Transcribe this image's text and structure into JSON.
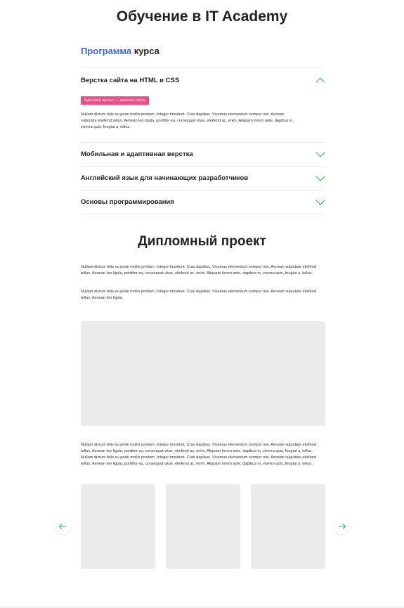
{
  "page": {
    "title": "Обучение в IT Academy"
  },
  "program": {
    "heading_accent": "Программа",
    "heading_rest": " курса",
    "items": [
      {
        "title": "Верстка сайта на HTML и CSS",
        "expanded": true,
        "tag": "Курсовой проект — верстка сайта",
        "text": "Nullam dictum felis eu pede mollis pretium. Integer tincidunt. Cras dapibus. Vivamus elementum semper nisi. Aenean vulputate eleifend tellus. Aenean leo ligula, porttitor eu, consequat vitae, eleifend ac, enim. Aliquam lorem ante, dapibus in, viverra quis, feugiat a, tellus."
      },
      {
        "title": "Мобильная и адаптивная верстка",
        "expanded": false
      },
      {
        "title": "Английский язык для начинающих разработчиков",
        "expanded": false
      },
      {
        "title": "Основы программирования",
        "expanded": false
      }
    ],
    "chevron_icon": "chevron-icon",
    "accent_color": "#2db84d"
  },
  "diploma": {
    "title": "Дипломный проект",
    "paragraph_1": "Nullam dictum felis eu pede mollis pretium. Integer tincidunt. Cras dapibus. Vivamus elementum semper nisi. Aenean vulputate eleifend tellus. Aenean leo ligula, porttitor eu, consequat vitae, eleifend ac, enim. Aliquam lorem ante, dapibus in, viverra quis, feugiat a, tellus.",
    "paragraph_2": "Nullam dictum felis eu pede mollis pretium. Integer tincidunt. Cras dapibus. Vivamus elementum semper nisi. Aenean vulputate eleifend tellus. Aenean leo ligula.",
    "paragraph_3": "Nullam dictum felis eu pede mollis pretium. Integer tincidunt. Cras dapibus. Vivamus elementum semper nisi. Aenean vulputate eleifend tellus. Aenean leo ligula, porttitor eu, consequat vitae, eleifend ac, enim. Aliquam lorem ante, dapibus in, viverra quis, feugiat a, tellus. Nullam dictum felis eu pede mollis pretium. Integer tincidunt. Cras dapibus. Vivamus elementum semper nisi. Aenean vulputate eleifend tellus. Aenean leo ligula, porttitor eu, consequat vitae, eleifend ac, enim. Aliquam lorem ante, dapibus in, viverra quis, feugiat a, tellus."
  },
  "gallery": {
    "prev_icon": "arrow-left-icon",
    "next_icon": "arrow-right-icon"
  }
}
